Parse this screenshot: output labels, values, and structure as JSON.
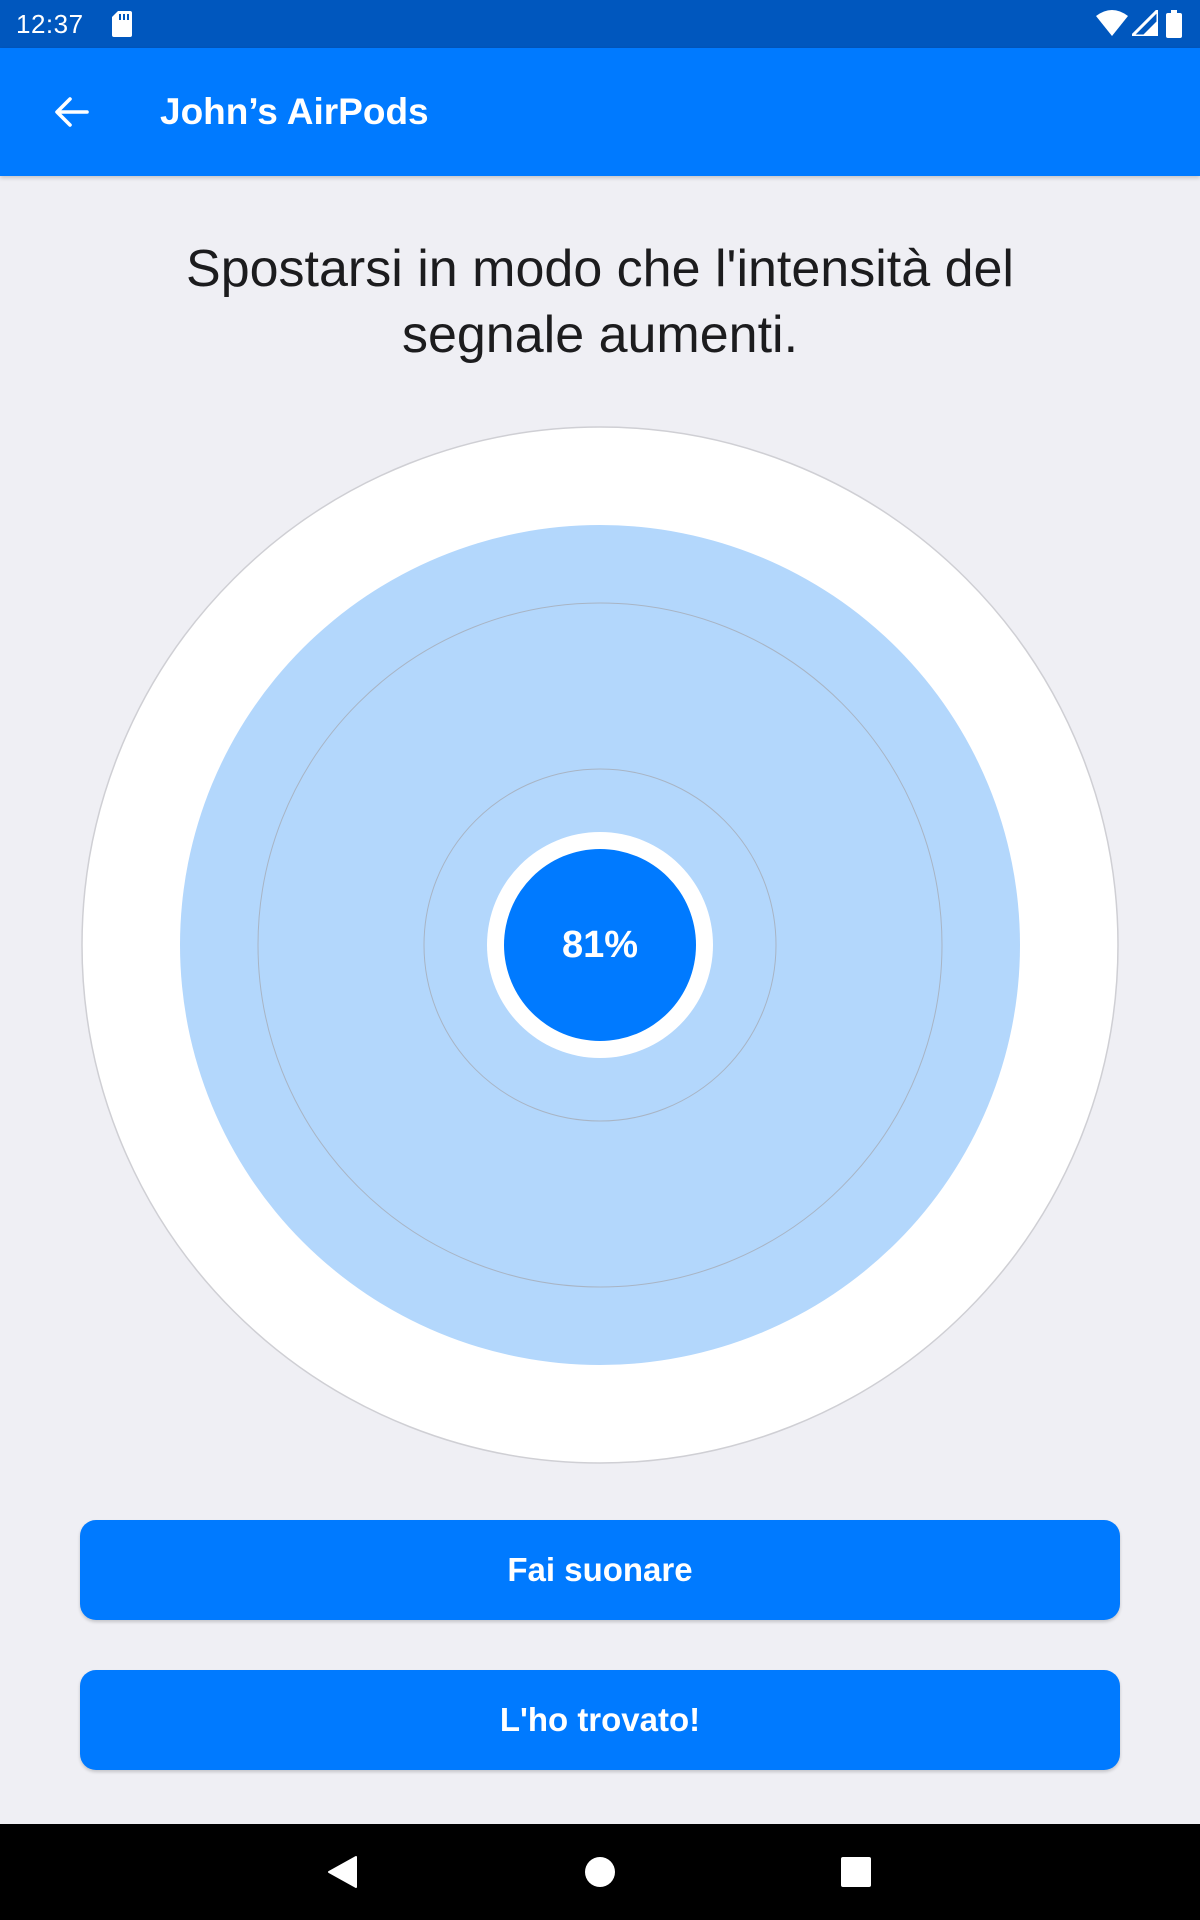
{
  "status_bar": {
    "time": "12:37",
    "icons": [
      "sd-card-icon",
      "wifi-icon",
      "cell-signal-icon",
      "battery-icon"
    ]
  },
  "app_bar": {
    "back_icon": "arrow-left-icon",
    "title": "John’s AirPods"
  },
  "instruction": "Spostarsi in modo che l'intensità del segnale aumenti.",
  "signal": {
    "percent_label": "81%",
    "strength": 0.81
  },
  "buttons": {
    "ring_label": "Fai suonare",
    "found_label": "L'ho trovato!"
  },
  "nav_bar": {
    "icons": [
      "back-triangle-icon",
      "home-circle-icon",
      "recents-square-icon"
    ]
  },
  "colors": {
    "status_bar": "#0057be",
    "app_bar": "#007aff",
    "accent": "#007aff",
    "signal_area": "#b3d7fc",
    "background": "#efeff4"
  }
}
